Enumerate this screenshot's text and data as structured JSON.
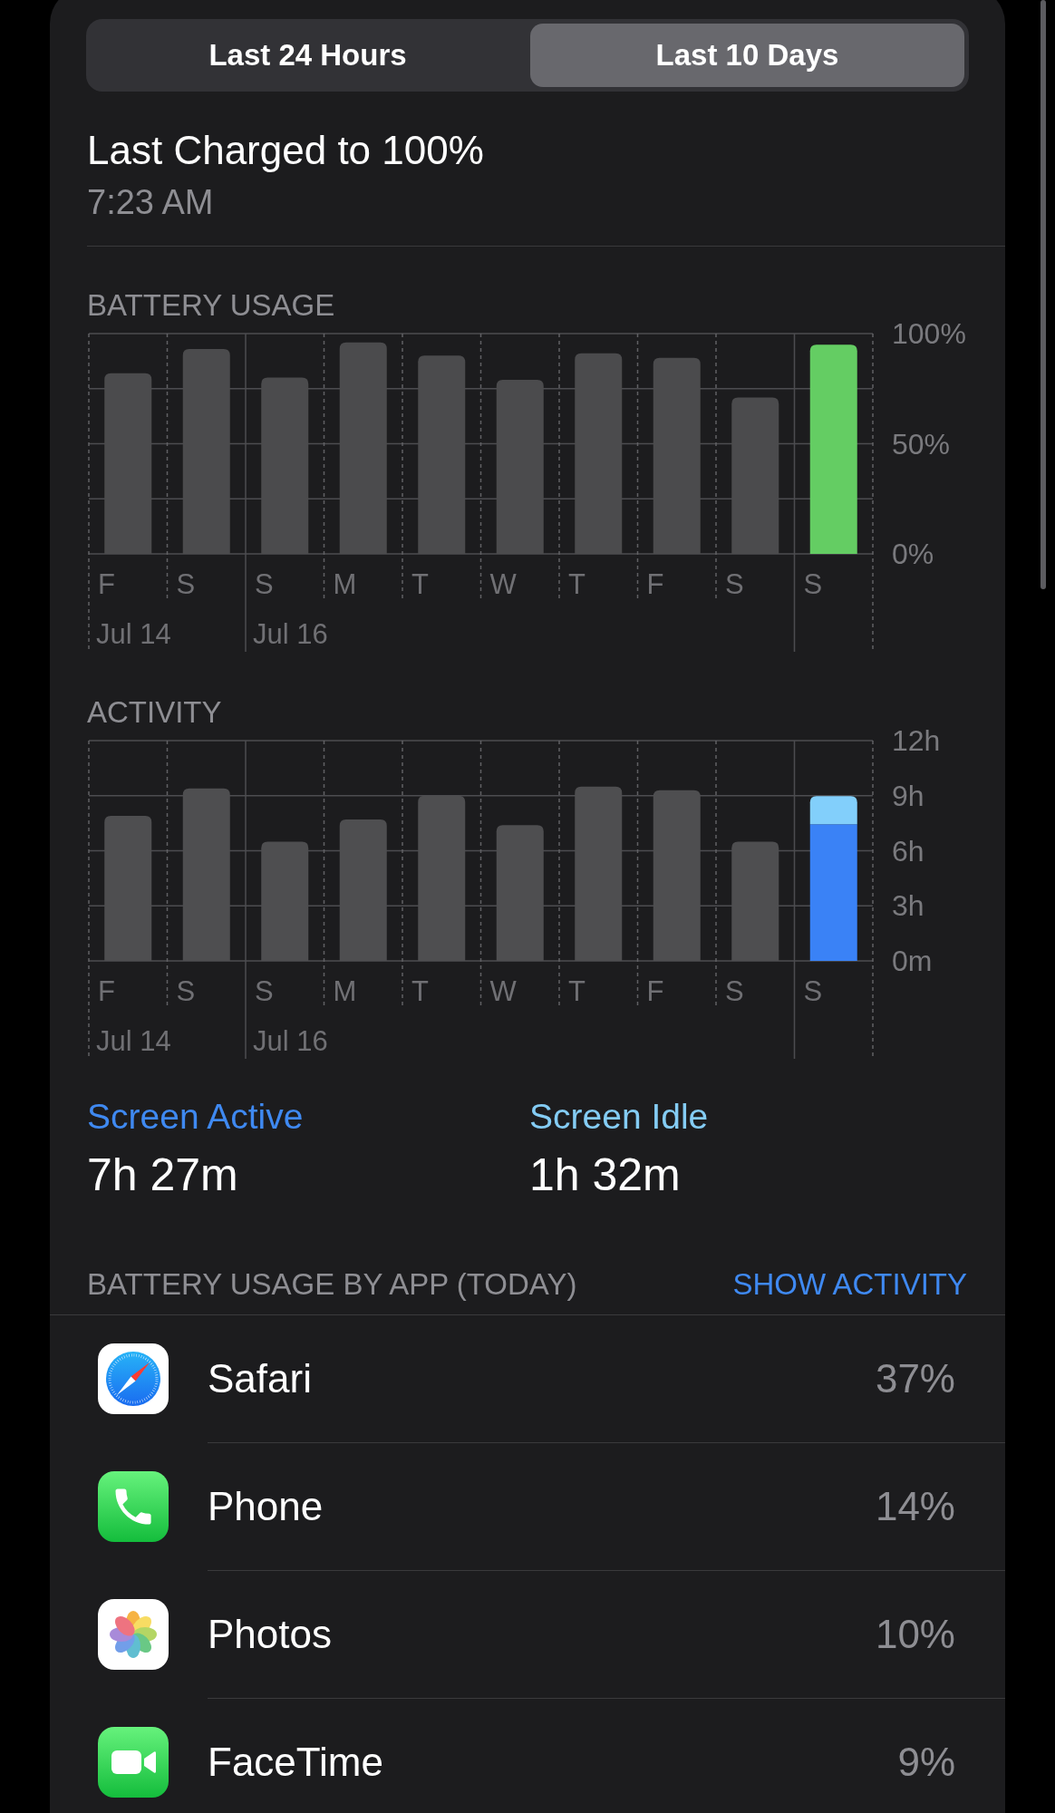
{
  "tabs": [
    {
      "label": "Last 24 Hours",
      "selected": false
    },
    {
      "label": "Last 10 Days",
      "selected": true
    }
  ],
  "last_charged": {
    "title": "Last Charged to 100%",
    "time": "7:23 AM"
  },
  "battery_usage": {
    "chart_data": {
      "type": "bar",
      "title": "BATTERY USAGE",
      "categories": [
        "F",
        "S",
        "S",
        "M",
        "T",
        "W",
        "T",
        "F",
        "S",
        "S"
      ],
      "series": [
        {
          "color": "#4b4b4d",
          "values": [
            82,
            93,
            80,
            96,
            90,
            79,
            91,
            89,
            71,
            null
          ]
        },
        {
          "color": "#64cd63",
          "values": [
            null,
            null,
            null,
            null,
            null,
            null,
            null,
            null,
            null,
            95
          ]
        }
      ],
      "ylim": [
        0,
        100
      ],
      "yticks": [
        {
          "value": 0,
          "label": "0%"
        },
        {
          "value": 50,
          "label": "50%"
        },
        {
          "value": 100,
          "label": "100%"
        }
      ],
      "annotations": [
        "Jul 14",
        "Jul 16"
      ],
      "grid": true
    }
  },
  "activity": {
    "chart_data": {
      "type": "bar",
      "title": "ACTIVITY",
      "categories": [
        "F",
        "S",
        "S",
        "M",
        "T",
        "W",
        "T",
        "F",
        "S",
        "S"
      ],
      "series": [
        {
          "color": "#4e4e50",
          "values": [
            7.9,
            9.4,
            6.5,
            7.7,
            9.0,
            7.4,
            9.5,
            9.3,
            6.5,
            null
          ]
        },
        {
          "color": "#3a82f6",
          "values": [
            null,
            null,
            null,
            null,
            null,
            null,
            null,
            null,
            null,
            7.45
          ]
        },
        {
          "color": "#82cffb",
          "values": [
            null,
            null,
            null,
            null,
            null,
            null,
            null,
            null,
            null,
            1.53
          ]
        }
      ],
      "ylim": [
        0,
        12
      ],
      "yticks": [
        {
          "value": 0,
          "label": "0m"
        },
        {
          "value": 3,
          "label": "3h"
        },
        {
          "value": 6,
          "label": "6h"
        },
        {
          "value": 9,
          "label": "9h"
        },
        {
          "value": 12,
          "label": "12h"
        }
      ],
      "annotations": [
        "Jul 14",
        "Jul 16"
      ],
      "stacked": true,
      "grid": true
    }
  },
  "screen_time": [
    {
      "label": "Screen Active",
      "value": "7h 27m",
      "color": "#3f89f1"
    },
    {
      "label": "Screen Idle",
      "value": "1h 32m",
      "color": "#84ccf4"
    }
  ],
  "app_usage": {
    "header": "BATTERY USAGE BY APP (TODAY)",
    "action": "SHOW ACTIVITY",
    "apps": [
      {
        "kind": "compass",
        "name": "Safari",
        "percent": "37%"
      },
      {
        "kind": "handset",
        "name": "Phone",
        "percent": "14%"
      },
      {
        "kind": "flower",
        "name": "Photos",
        "percent": "10%"
      },
      {
        "kind": "camera",
        "name": "FaceTime",
        "percent": "9%"
      }
    ]
  }
}
